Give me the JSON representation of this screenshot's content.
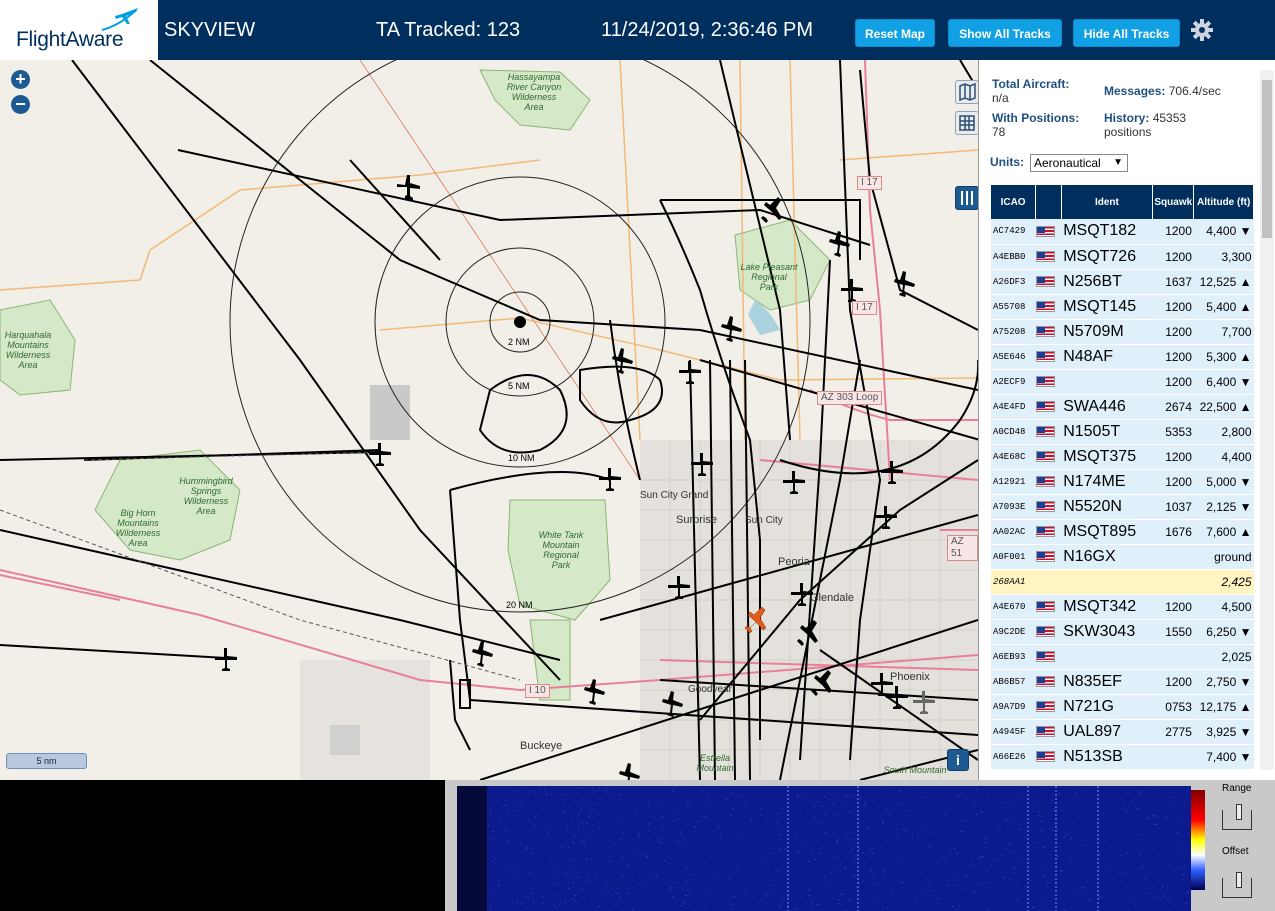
{
  "header": {
    "logo_text": "FlightAware",
    "title": "SKYVIEW",
    "tracked": "TA Tracked: 123",
    "datetime": "11/24/2019, 2:36:46 PM",
    "buttons": {
      "reset_map": "Reset Map",
      "show_all_tracks": "Show All Tracks",
      "hide_all_tracks": "Hide All Tracks"
    }
  },
  "map": {
    "zoom_in": "+",
    "zoom_out": "−",
    "range_rings": [
      "2 NM",
      "5 NM",
      "10 NM",
      "20 NM"
    ],
    "scale": "5 nm",
    "places": {
      "hassayampa": "Hassayampa\nRiver Canyon\nWilderness\nArea",
      "harquahala": "Harquahala\nMountains\nWilderness\nArea",
      "lake_pleasant": "Lake Pleasant\nRegional\nPark",
      "hummingbird": "Hummingbird\nSprings\nWilderness\nArea",
      "big_horn": "Big Horn\nMountains\nWilderness\nArea",
      "white_tank": "White Tank\nMountain\nRegional\nPark",
      "sun_city_grand": "Sun City Grand",
      "surprise": "Surprise",
      "sun_city": "Sun City",
      "peoria": "Peoria",
      "glendale": "Glendale",
      "phoenix": "Phoenix",
      "buckeye": "Buckeye",
      "goodyear": "Goodyear",
      "estrella": "Estrella\nMountain",
      "south_mountain": "South Mountain"
    },
    "shields": {
      "i17a": "I 17",
      "i17b": "I 17",
      "loop303": "AZ 303 Loop",
      "az51": "AZ 51",
      "i10": "I 10"
    }
  },
  "panel": {
    "total_aircraft_label": "Total Aircraft:",
    "total_aircraft_value": "n/a",
    "with_positions_label": "With Positions:",
    "with_positions_value": "78",
    "messages_label": "Messages:",
    "messages_value": "706.4/sec",
    "history_label": "History:",
    "history_value": "45353",
    "history_unit": "positions",
    "units_label": "Units:",
    "units_value": "Aeronautical",
    "columns": {
      "icao": "ICAO",
      "ident": "Ident",
      "squawk": "Squawk",
      "altitude": "Altitude (ft)"
    },
    "rows": [
      {
        "icao": "AC7429",
        "flag": true,
        "ident": "MSQT182",
        "squawk": "1200",
        "alt": "4,400 ▼"
      },
      {
        "icao": "A4EBB0",
        "flag": true,
        "ident": "MSQT726",
        "squawk": "1200",
        "alt": "3,300"
      },
      {
        "icao": "A26DF3",
        "flag": true,
        "ident": "N256BT",
        "squawk": "1637",
        "alt": "12,525 ▲"
      },
      {
        "icao": "A55708",
        "flag": true,
        "ident": "MSQT145",
        "squawk": "1200",
        "alt": "5,400 ▲"
      },
      {
        "icao": "A75208",
        "flag": true,
        "ident": "N5709M",
        "squawk": "1200",
        "alt": "7,700"
      },
      {
        "icao": "A5E646",
        "flag": true,
        "ident": "N48AF",
        "squawk": "1200",
        "alt": "5,300 ▲"
      },
      {
        "icao": "A2ECF9",
        "flag": true,
        "ident": "",
        "squawk": "1200",
        "alt": "6,400 ▼"
      },
      {
        "icao": "A4E4FD",
        "flag": true,
        "ident": "SWA446",
        "squawk": "2674",
        "alt": "22,500 ▲"
      },
      {
        "icao": "A0CD48",
        "flag": true,
        "ident": "N1505T",
        "squawk": "5353",
        "alt": "2,800"
      },
      {
        "icao": "A4E68C",
        "flag": true,
        "ident": "MSQT375",
        "squawk": "1200",
        "alt": "4,400"
      },
      {
        "icao": "A12921",
        "flag": true,
        "ident": "N174ME",
        "squawk": "1200",
        "alt": "5,000 ▼"
      },
      {
        "icao": "A7093E",
        "flag": true,
        "ident": "N5520N",
        "squawk": "1037",
        "alt": "2,125 ▼"
      },
      {
        "icao": "AA02AC",
        "flag": true,
        "ident": "MSQT895",
        "squawk": "1676",
        "alt": "7,600 ▲"
      },
      {
        "icao": "A0F001",
        "flag": true,
        "ident": "N16GX",
        "squawk": "",
        "alt": "ground"
      },
      {
        "icao": "268AA1",
        "flag": false,
        "ident": "",
        "squawk": "",
        "alt": "2,425",
        "highlight": true
      },
      {
        "icao": "A4E670",
        "flag": true,
        "ident": "MSQT342",
        "squawk": "1200",
        "alt": "4,500"
      },
      {
        "icao": "A9C2DE",
        "flag": true,
        "ident": "SKW3043",
        "squawk": "1550",
        "alt": "6,250 ▼"
      },
      {
        "icao": "A6EB93",
        "flag": true,
        "ident": "",
        "squawk": "",
        "alt": "2,025"
      },
      {
        "icao": "AB6B57",
        "flag": true,
        "ident": "N835EF",
        "squawk": "1200",
        "alt": "2,750 ▼"
      },
      {
        "icao": "A9A7D9",
        "flag": true,
        "ident": "N721G",
        "squawk": "0753",
        "alt": "12,175 ▲"
      },
      {
        "icao": "A4945F",
        "flag": true,
        "ident": "UAL897",
        "squawk": "2775",
        "alt": "3,925 ▼"
      },
      {
        "icao": "A66E26",
        "flag": true,
        "ident": "N513SB",
        "squawk": "",
        "alt": "7,400 ▼"
      }
    ]
  },
  "spectrum": {
    "range_label": "Range",
    "offset_label": "Offset"
  },
  "colors": {
    "header_bg": "#002f5d",
    "button": "#12a0e4",
    "table_header": "#002f5d",
    "row_bg": "#dff0fb",
    "highlight_row": "#fff4c2"
  }
}
